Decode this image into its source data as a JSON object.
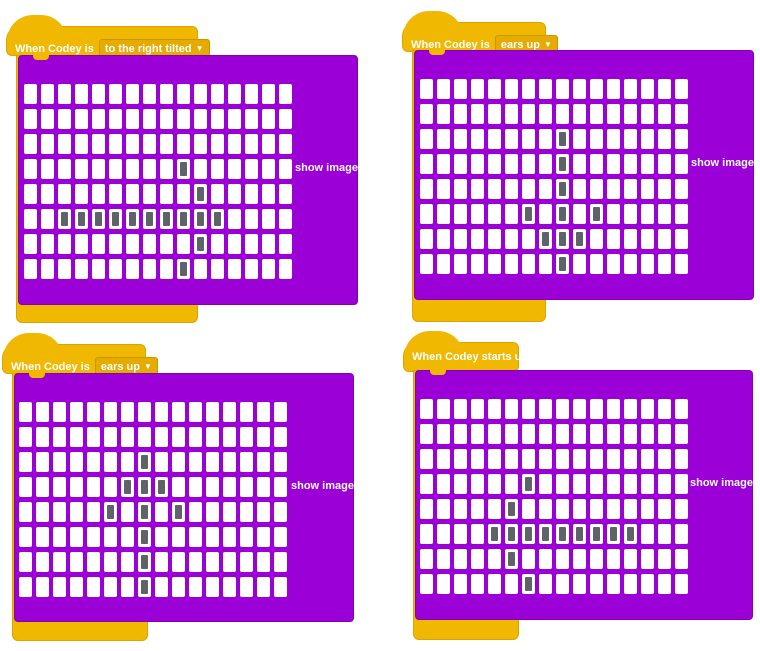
{
  "colors": {
    "event_yellow": "#f0b800",
    "looks_purple": "#9b00d6",
    "pixel_on": "#5e6369",
    "pixel_off": "#ffffff"
  },
  "blocks": [
    {
      "hat_label": "When Codey is",
      "dropdown_value": "to the right tilted",
      "action_label": "show image",
      "pixels_on": [
        [
          3,
          9
        ],
        [
          4,
          10
        ],
        [
          5,
          2
        ],
        [
          5,
          3
        ],
        [
          5,
          4
        ],
        [
          5,
          5
        ],
        [
          5,
          6
        ],
        [
          5,
          7
        ],
        [
          5,
          8
        ],
        [
          5,
          9
        ],
        [
          5,
          10
        ],
        [
          5,
          11
        ],
        [
          6,
          10
        ],
        [
          7,
          9
        ]
      ]
    },
    {
      "hat_label": "When Codey is",
      "dropdown_value": "ears up",
      "action_label": "show image",
      "pixels_on": [
        [
          2,
          8
        ],
        [
          3,
          8
        ],
        [
          4,
          8
        ],
        [
          5,
          6
        ],
        [
          5,
          8
        ],
        [
          5,
          10
        ],
        [
          6,
          7
        ],
        [
          6,
          8
        ],
        [
          6,
          9
        ],
        [
          7,
          8
        ]
      ]
    },
    {
      "hat_label": "When Codey is",
      "dropdown_value": "ears up",
      "action_label": "show image",
      "pixels_on": [
        [
          2,
          7
        ],
        [
          3,
          6
        ],
        [
          3,
          7
        ],
        [
          3,
          8
        ],
        [
          4,
          5
        ],
        [
          4,
          7
        ],
        [
          4,
          9
        ],
        [
          5,
          7
        ],
        [
          6,
          7
        ],
        [
          7,
          7
        ]
      ]
    },
    {
      "hat_label": "When Codey starts up",
      "dropdown_value": "",
      "action_label": "show image",
      "pixels_on": [
        [
          3,
          6
        ],
        [
          4,
          5
        ],
        [
          5,
          4
        ],
        [
          5,
          5
        ],
        [
          5,
          6
        ],
        [
          5,
          7
        ],
        [
          5,
          8
        ],
        [
          5,
          9
        ],
        [
          5,
          10
        ],
        [
          5,
          11
        ],
        [
          5,
          12
        ],
        [
          6,
          5
        ],
        [
          7,
          6
        ]
      ]
    }
  ]
}
